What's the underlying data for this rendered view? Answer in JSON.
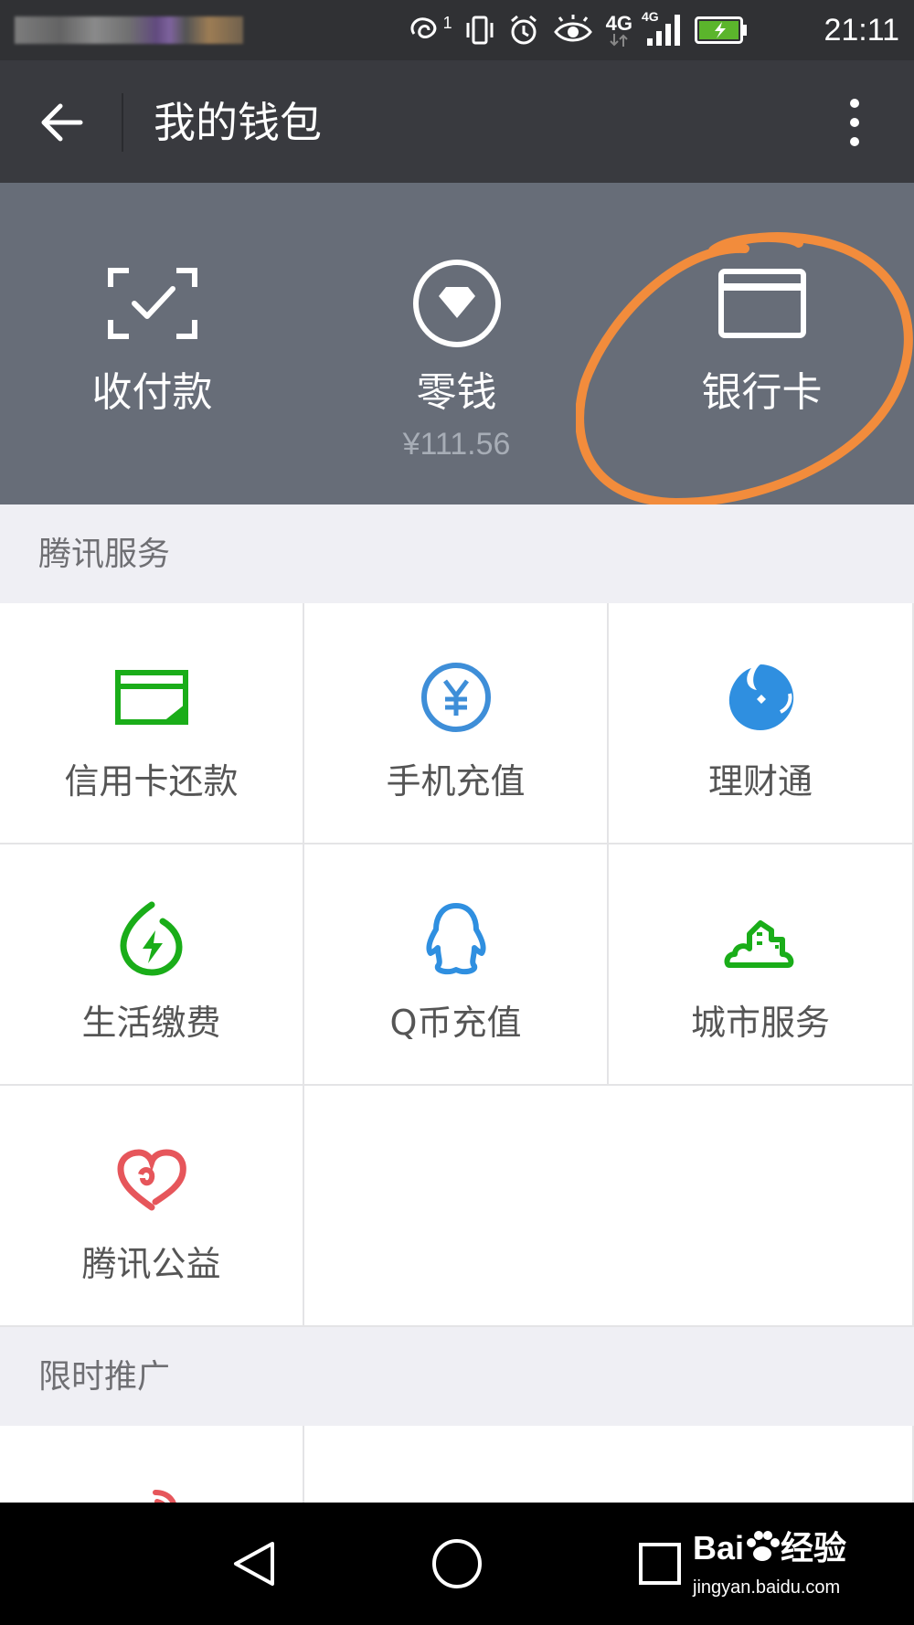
{
  "status_bar": {
    "time": "21:11",
    "sim_badge": "1",
    "network_label": "4G",
    "network_label_small": "4G",
    "icons": [
      "notification-blurred",
      "hd-call-icon",
      "vibrate-icon",
      "alarm-icon",
      "eye-icon",
      "network-4g-icon",
      "signal-icon",
      "battery-charging-icon"
    ]
  },
  "app_bar": {
    "title": "我的钱包",
    "back_icon": "arrow-left-icon",
    "more_icon": "more-vertical-icon"
  },
  "header": {
    "items": [
      {
        "label": "收付款",
        "icon": "scan-check-icon"
      },
      {
        "label": "零钱",
        "sub": "¥111.56",
        "icon": "diamond-circle-icon"
      },
      {
        "label": "银行卡",
        "icon": "bank-card-icon",
        "highlighted": true
      }
    ],
    "highlight_color": "#f28c3c"
  },
  "sections": [
    {
      "title": "腾讯服务",
      "items": [
        {
          "label": "信用卡还款",
          "icon": "credit-card-icon",
          "color": "#1aad19"
        },
        {
          "label": "手机充值",
          "icon": "yuan-circle-icon",
          "color": "#3e8ed8"
        },
        {
          "label": "理财通",
          "icon": "wealth-icon",
          "color": "#2f8fe0"
        },
        {
          "label": "生活缴费",
          "icon": "lightning-icon",
          "color": "#1aad19"
        },
        {
          "label": "Q币充值",
          "icon": "penguin-icon",
          "color": "#2f8fe0"
        },
        {
          "label": "城市服务",
          "icon": "city-icon",
          "color": "#1aad19"
        },
        {
          "label": "腾讯公益",
          "icon": "heart-icon",
          "color": "#e6565b"
        }
      ]
    },
    {
      "title": "限时推广",
      "items": []
    }
  ],
  "nav_bar": {
    "icons": [
      "back-triangle-icon",
      "home-circle-icon",
      "recents-square-icon"
    ]
  },
  "watermark": {
    "main": "Bai",
    "main_cn": "经验",
    "sub": "jingyan.baidu.com"
  }
}
